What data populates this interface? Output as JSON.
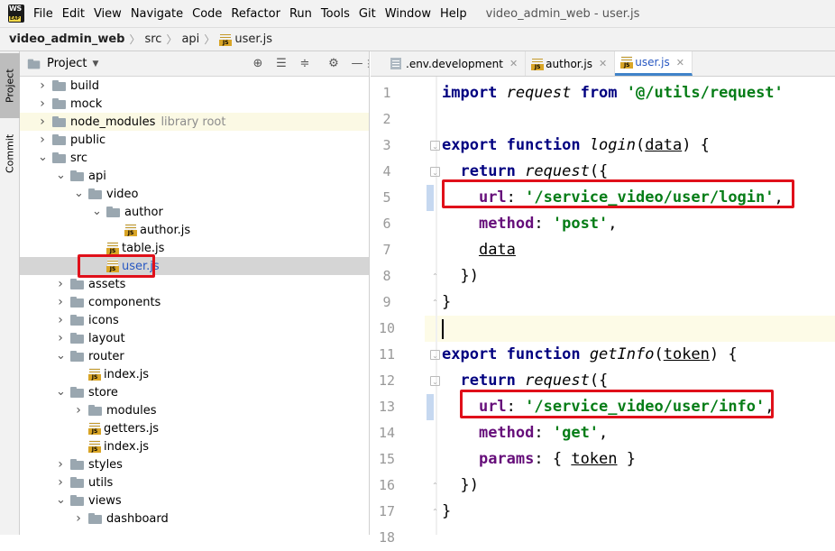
{
  "menubar": {
    "logo": {
      "top": "WS",
      "bottom": "EAP"
    },
    "items": [
      "File",
      "Edit",
      "View",
      "Navigate",
      "Code",
      "Refactor",
      "Run",
      "Tools",
      "Git",
      "Window",
      "Help"
    ],
    "window_title": "video_admin_web - user.js"
  },
  "breadcrumb": {
    "project": "video_admin_web",
    "parts": [
      "src",
      "api"
    ],
    "file": "user.js"
  },
  "sidebar_tabs": {
    "project": "Project",
    "commit": "Commit"
  },
  "project_panel": {
    "title": "Project",
    "tree": [
      {
        "label": "build",
        "type": "folder",
        "expanded": false
      },
      {
        "label": "mock",
        "type": "folder",
        "expanded": false
      },
      {
        "label": "node_modules",
        "type": "folder",
        "expanded": false,
        "suffix": "library root"
      },
      {
        "label": "public",
        "type": "folder",
        "expanded": false
      },
      {
        "label": "src",
        "type": "folder",
        "expanded": true
      },
      {
        "label": "api",
        "type": "folder",
        "expanded": true
      },
      {
        "label": "video",
        "type": "folder",
        "expanded": true
      },
      {
        "label": "author",
        "type": "folder",
        "expanded": true
      },
      {
        "label": "author.js",
        "type": "js"
      },
      {
        "label": "table.js",
        "type": "js"
      },
      {
        "label": "user.js",
        "type": "js",
        "selected": true
      },
      {
        "label": "assets",
        "type": "folder",
        "expanded": false
      },
      {
        "label": "components",
        "type": "folder",
        "expanded": false
      },
      {
        "label": "icons",
        "type": "folder",
        "expanded": false
      },
      {
        "label": "layout",
        "type": "folder",
        "expanded": false
      },
      {
        "label": "router",
        "type": "folder",
        "expanded": true
      },
      {
        "label": "index.js",
        "type": "js"
      },
      {
        "label": "store",
        "type": "folder",
        "expanded": true
      },
      {
        "label": "modules",
        "type": "folder",
        "expanded": false
      },
      {
        "label": "getters.js",
        "type": "js"
      },
      {
        "label": "index.js",
        "type": "js"
      },
      {
        "label": "styles",
        "type": "folder",
        "expanded": false
      },
      {
        "label": "utils",
        "type": "folder",
        "expanded": false
      },
      {
        "label": "views",
        "type": "folder",
        "expanded": true
      },
      {
        "label": "dashboard",
        "type": "folder",
        "expanded": false
      }
    ]
  },
  "editor_tabs": [
    {
      "label": ".env.development",
      "icon": "env",
      "active": false
    },
    {
      "label": "author.js",
      "icon": "js",
      "active": false
    },
    {
      "label": "user.js",
      "icon": "js",
      "active": true
    }
  ],
  "code_lines": [
    "import request from '@/utils/request'",
    "",
    "export function login(data) {",
    "  return request({",
    "    url: '/service_video/user/login',",
    "    method: 'post',",
    "    data",
    "  })",
    "}",
    "",
    "export function getInfo(token) {",
    "  return request({",
    "    url: '/service_video/user/info',",
    "    method: 'get',",
    "    params: { token }",
    "  })",
    "}",
    ""
  ],
  "line_numbers": [
    "1",
    "2",
    "3",
    "4",
    "5",
    "6",
    "7",
    "8",
    "9",
    "10",
    "11",
    "12",
    "13",
    "14",
    "15",
    "16",
    "17",
    "18"
  ],
  "current_line": "10",
  "colors": {
    "highlight_box": "#e0101a",
    "keyword": "#000080",
    "string": "#067d17",
    "property": "#660e7a"
  }
}
